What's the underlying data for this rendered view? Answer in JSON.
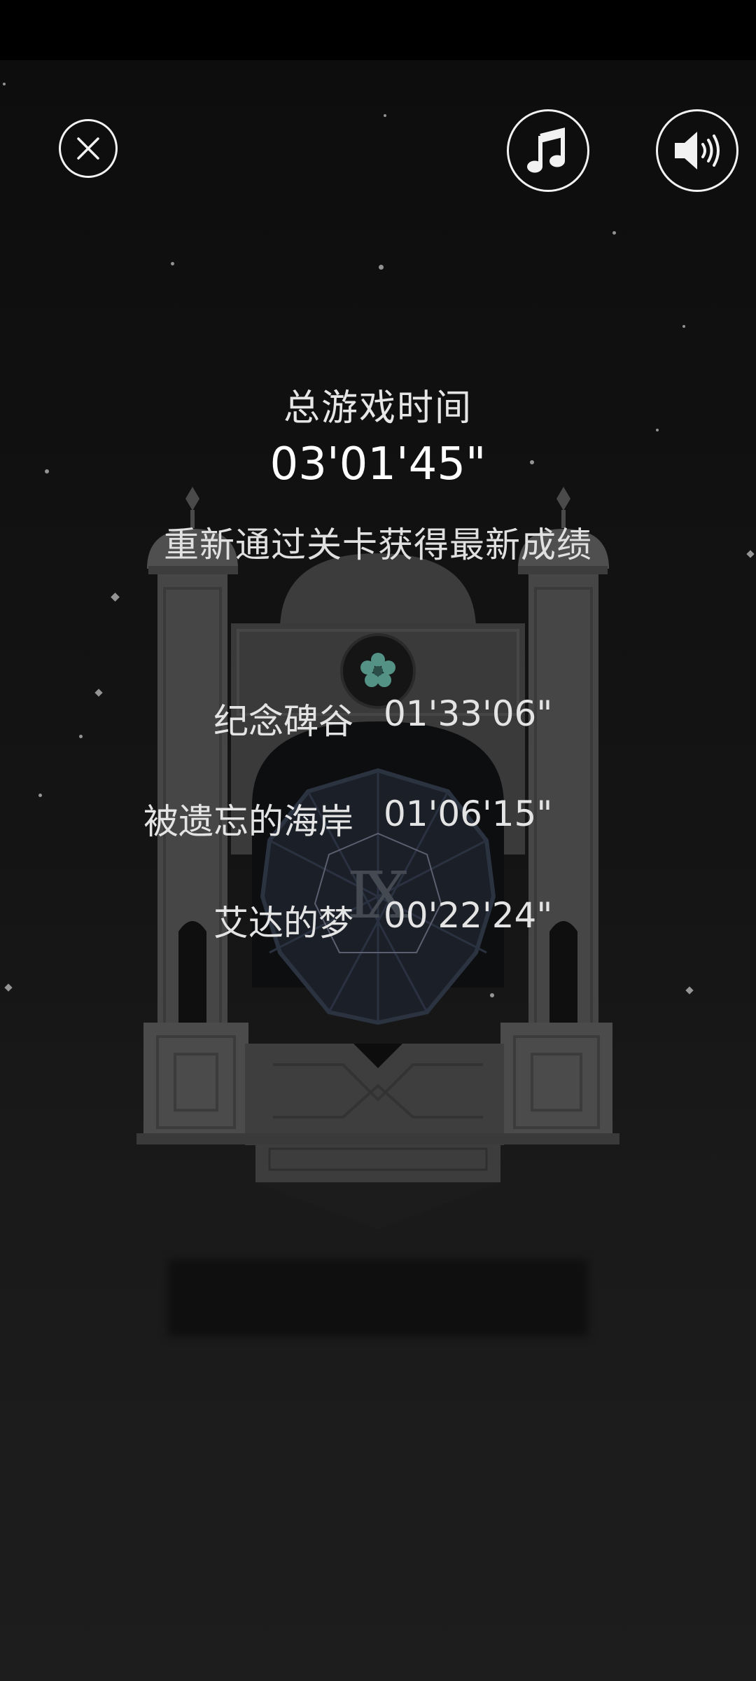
{
  "summary": {
    "total_label": "总游戏时间",
    "total_time": "03'01'45\"",
    "replay_hint": "重新通过关卡获得最新成绩"
  },
  "levels": [
    {
      "name": "纪念碑谷",
      "time": "01'33'06\""
    },
    {
      "name": "被遗忘的海岸",
      "time": "01'06'15\""
    },
    {
      "name": "艾达的梦",
      "time": "00'22'24\""
    }
  ],
  "monument": {
    "numeral": "Ⅸ"
  },
  "icons": {
    "close": "close-icon",
    "music": "music-note-icon",
    "sound": "speaker-volume-icon",
    "flower": "flower-icon"
  },
  "colors": {
    "background": "#0d0d0d",
    "stone": "#4a4a4a",
    "stone_dark": "#2e2e2e",
    "gem_glow": "#5fa89a"
  }
}
